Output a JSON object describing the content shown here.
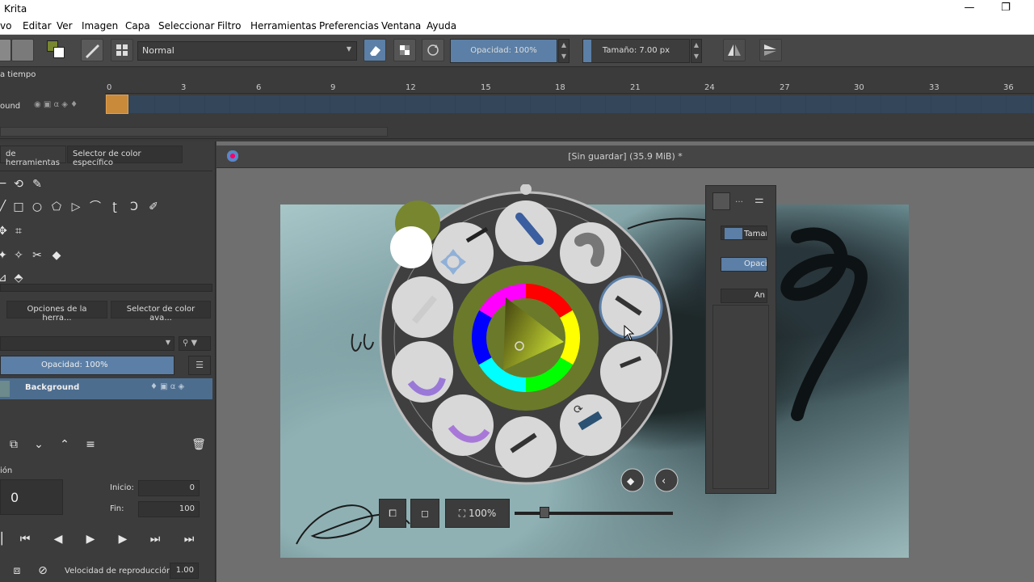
{
  "window": {
    "title": "Krita",
    "minimize": "—",
    "restore": "❐"
  },
  "menu": [
    "vo",
    "Editar",
    "Ver",
    "Imagen",
    "Capa",
    "Seleccionar",
    "Filtro",
    "Herramientas",
    "Preferencias",
    "Ventana",
    "Ayuda"
  ],
  "toolbar": {
    "blend_mode": "Normal",
    "opacity_label": "Opacidad: 100%",
    "opacity_value": 1.0,
    "size_label": "Tamaño: 7.00 px",
    "size_fraction": 0.08
  },
  "timeline": {
    "title": "a tiempo",
    "ticks": [
      "0",
      "3",
      "6",
      "9",
      "12",
      "15",
      "18",
      "21",
      "24",
      "27",
      "30",
      "33",
      "36"
    ],
    "layer_name": "ound"
  },
  "left": {
    "tab_tools": "de herramientas",
    "tab_color": "Selector de color específico",
    "tab_options": "Opciones de la herra...",
    "tab_advcolor": "Selector de color ava...",
    "layer_opacity": "Opacidad:  100%",
    "layer_name": "Background",
    "anim_title": "ión",
    "frame_value": "0",
    "start_label": "Inicio:",
    "start_value": "0",
    "end_label": "Fin:",
    "end_value": "100",
    "speed_label": "Velocidad de reproducción:",
    "speed_value": "1.00"
  },
  "document": {
    "title": "[Sin guardar]  (35.9 MiB) *"
  },
  "popup": {
    "size_label": "Tamaño",
    "opacity_label": "Opacio",
    "angle_label": "An"
  },
  "palette": {
    "zoom_label": "100%",
    "zoom_fraction": 0.19
  },
  "colors": {
    "accent": "#5b7fa6",
    "foreground": "#78862f",
    "wheel_ring": "#3f3f3f"
  }
}
